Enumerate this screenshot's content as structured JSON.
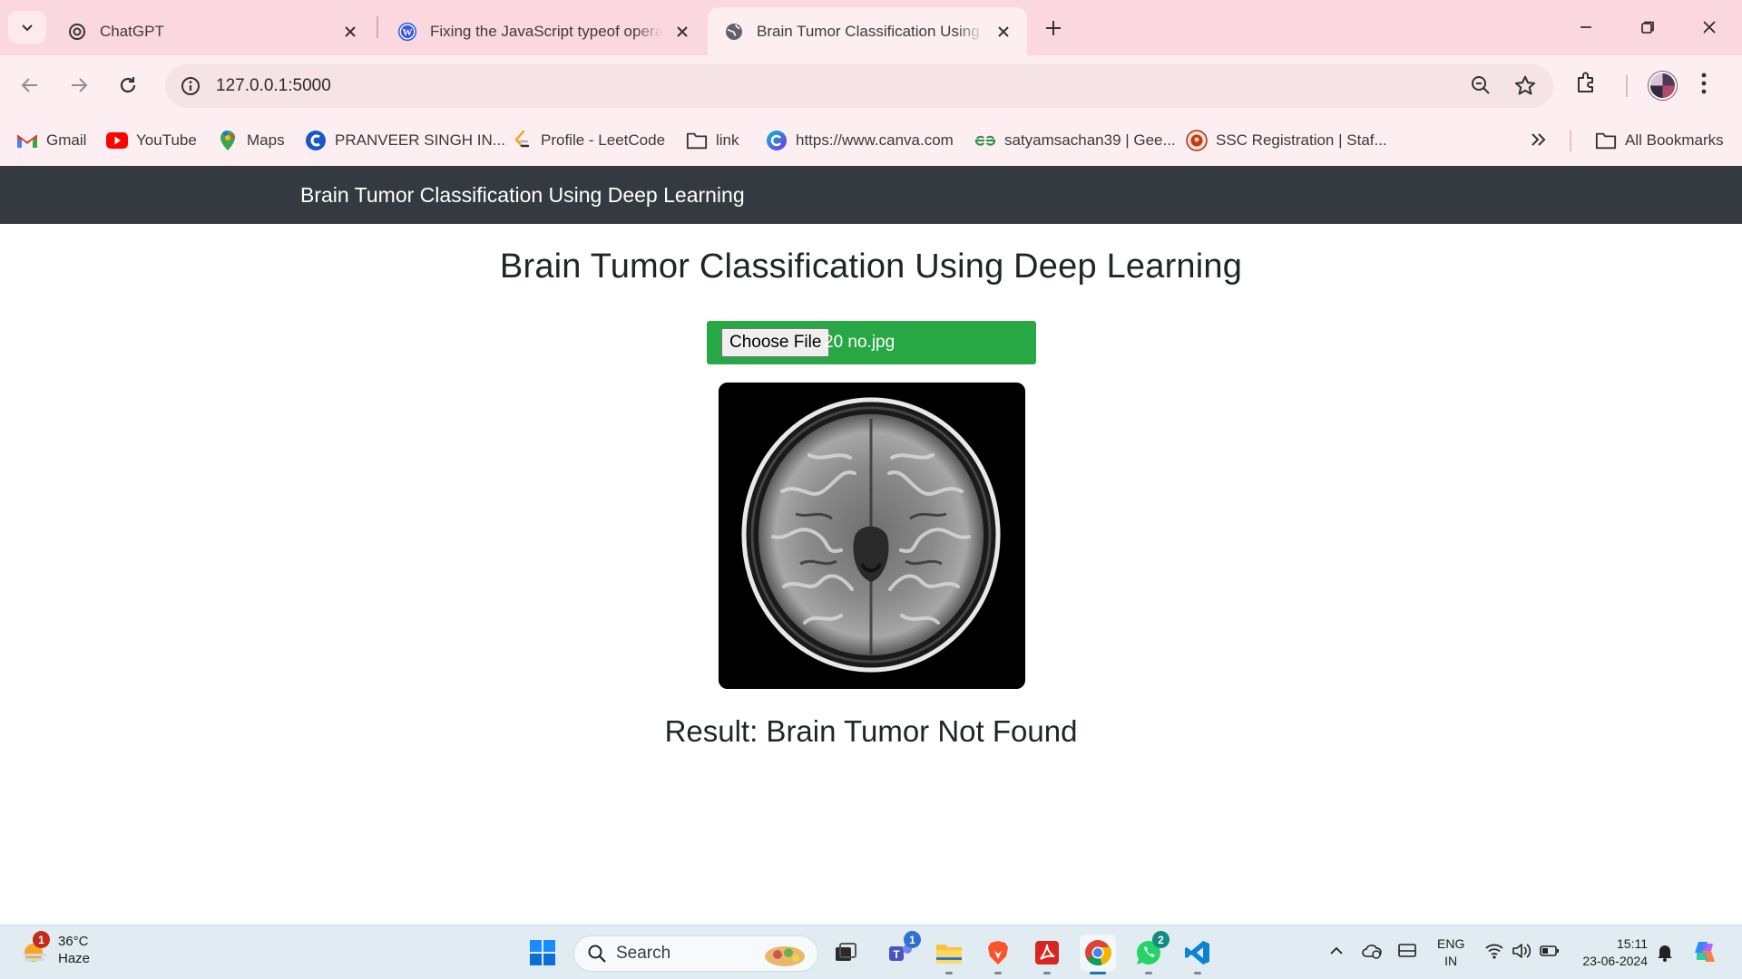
{
  "browser": {
    "tabs": [
      {
        "title": "ChatGPT",
        "active": false,
        "icon": "chatgpt-icon"
      },
      {
        "title": "Fixing the JavaScript typeof operat",
        "active": false,
        "icon": "wordpress-icon"
      },
      {
        "title": "Brain Tumor Classification Using D",
        "active": true,
        "icon": "globe-icon"
      }
    ],
    "url": "127.0.0.1:5000",
    "bookmarks": [
      {
        "label": "Gmail",
        "icon": "gmail-icon"
      },
      {
        "label": "YouTube",
        "icon": "youtube-icon"
      },
      {
        "label": "Maps",
        "icon": "maps-icon"
      },
      {
        "label": "PRANVEER SINGH IN...",
        "icon": "psit-icon"
      },
      {
        "label": "Profile - LeetCode",
        "icon": "leetcode-icon"
      },
      {
        "label": "link",
        "icon": "folder-icon"
      },
      {
        "label": "https://www.canva.com",
        "icon": "canva-icon"
      },
      {
        "label": "satyamsachan39 | Gee...",
        "icon": "geeksforgeeks-icon"
      },
      {
        "label": "SSC Registration | Staf...",
        "icon": "ssc-icon"
      }
    ],
    "all_bookmarks": "All Bookmarks"
  },
  "page": {
    "navbar_brand": "Brain Tumor Classification Using Deep Learning",
    "heading": "Brain Tumor Classification Using Deep Learning",
    "file_button": "Choose File",
    "file_name": "20 no.jpg",
    "result": "Result: Brain Tumor Not Found"
  },
  "taskbar": {
    "weather_temp": "36°C",
    "weather_desc": "Haze",
    "weather_badge": "1",
    "search_label": "Search",
    "teams_badge": "1",
    "whatsapp_badge": "2",
    "lang_line1": "ENG",
    "lang_line2": "IN",
    "time": "15:11",
    "date": "23-06-2024"
  },
  "colors": {
    "tabstrip": "#fbd7df",
    "toolbar": "#fdeef1",
    "navbar": "#343a40",
    "file_box": "#28a745",
    "taskbar": "#e1ecf2"
  }
}
